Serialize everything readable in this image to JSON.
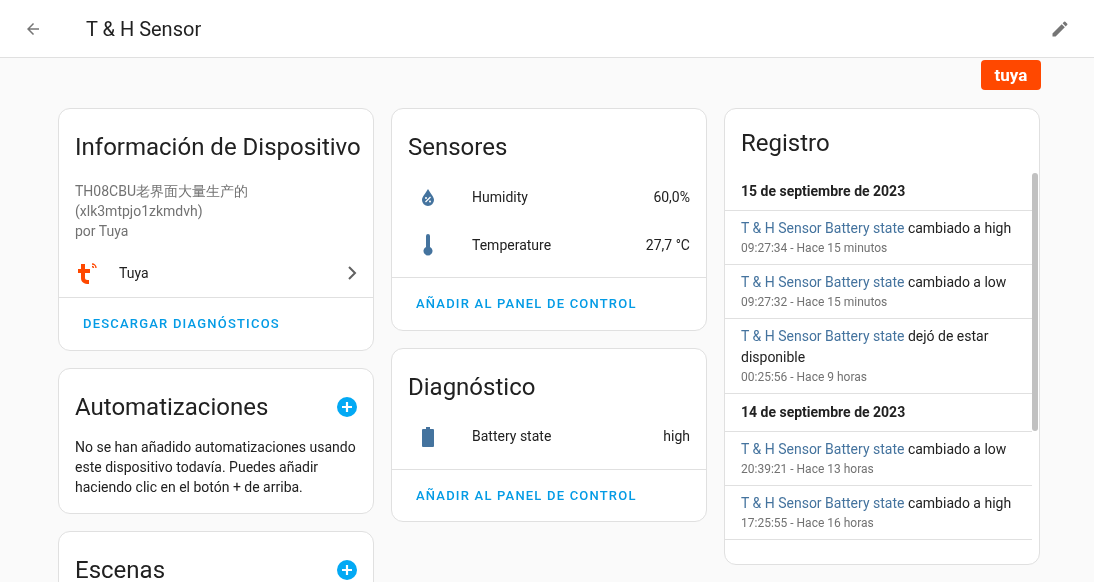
{
  "header": {
    "title": "T & H Sensor"
  },
  "brand_logo": {
    "text": "tuya"
  },
  "device_info": {
    "title": "Información de Dispositivo",
    "model": "TH08CBU老界面大量生产的",
    "model_id": "(xlk3mtpjo1zkmdvh)",
    "manufacturer": "por Tuya",
    "integration": "Tuya",
    "action": "DESCARGAR DIAGNÓSTICOS"
  },
  "automations": {
    "title": "Automatizaciones",
    "text": "No se han añadido automatizaciones usando este dispositivo todavía. Puedes añadir haciendo clic en el botón + de arriba."
  },
  "scenes": {
    "title": "Escenas"
  },
  "sensors": {
    "title": "Sensores",
    "rows": [
      {
        "kind": "humidity",
        "name": "Humidity",
        "value": "60,0%"
      },
      {
        "kind": "temperature",
        "name": "Temperature",
        "value": "27,7 °C"
      }
    ],
    "action": "AÑADIR AL PANEL DE CONTROL"
  },
  "diagnostics": {
    "title": "Diagnóstico",
    "rows": [
      {
        "kind": "battery",
        "name": "Battery state",
        "value": "high"
      }
    ],
    "action": "AÑADIR AL PANEL DE CONTROL"
  },
  "logbook": {
    "title": "Registro",
    "days": [
      {
        "date": "15 de septiembre de 2023",
        "entries": [
          {
            "entity": "T & H Sensor Battery state",
            "message": "cambiado a high",
            "time": "09:27:34 - Hace 15 minutos"
          },
          {
            "entity": "T & H Sensor Battery state",
            "message": "cambiado a low",
            "time": "09:27:32 - Hace 15 minutos"
          },
          {
            "entity": "T & H Sensor Battery state",
            "message": "dejó de estar disponible",
            "time": "00:25:56 - Hace 9 horas"
          }
        ]
      },
      {
        "date": "14 de septiembre de 2023",
        "entries": [
          {
            "entity": "T & H Sensor Battery state",
            "message": "cambiado a low",
            "time": "20:39:21 - Hace 13 horas"
          },
          {
            "entity": "T & H Sensor Battery state",
            "message": "cambiado a high",
            "time": "17:25:55 - Hace 16 horas"
          }
        ]
      }
    ]
  }
}
